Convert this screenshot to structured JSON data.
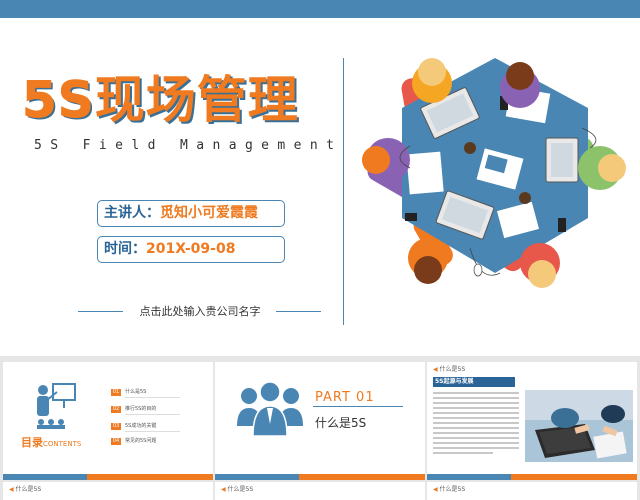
{
  "main_slide": {
    "title_5s": "5S",
    "title_rest": "现场管理",
    "subtitle": "5S Field Management",
    "speaker_label": "主讲人：",
    "speaker_value": "觅知小可爱霞霞",
    "date_label": "时间：",
    "date_value": "201X-09-08",
    "company_placeholder": "点击此处输入贵公司名字"
  },
  "thumb_toc": {
    "title": "目录",
    "title_en": "CONTENTS",
    "items": [
      {
        "num": "01",
        "label": "什么是5S"
      },
      {
        "num": "02",
        "label": "推行5S的目的"
      },
      {
        "num": "03",
        "label": "5S成功的关键"
      },
      {
        "num": "04",
        "label": "常见的5S问题"
      }
    ]
  },
  "thumb_part": {
    "part": "PART  01",
    "title": "什么是5S"
  },
  "thumb_section": {
    "head": "什么是5S",
    "section_title": "5S起源与发展"
  },
  "thumb_row2": {
    "heads": [
      "什么是5S",
      "什么是5S",
      "什么是5S"
    ]
  },
  "colors": {
    "accent_orange": "#f07a1f",
    "accent_blue": "#4a86b3",
    "dark_blue": "#2a6496"
  }
}
